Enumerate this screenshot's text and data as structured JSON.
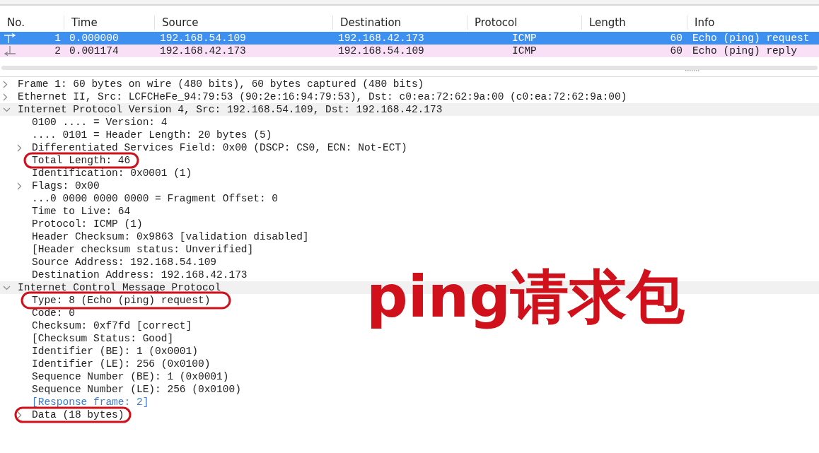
{
  "packet_list": {
    "columns": [
      "No.",
      "Time",
      "Source",
      "Destination",
      "Protocol",
      "Length",
      "Info"
    ],
    "rows": [
      {
        "no": "1",
        "time": "0.000000",
        "source": "192.168.54.109",
        "destination": "192.168.42.173",
        "protocol": "ICMP",
        "length": "60",
        "info": "Echo (ping) request",
        "kind": "request",
        "selected": true
      },
      {
        "no": "2",
        "time": "0.001174",
        "source": "192.168.42.173",
        "destination": "192.168.54.109",
        "protocol": "ICMP",
        "length": "60",
        "info": "Echo (ping) reply",
        "kind": "reply",
        "selected": false
      }
    ]
  },
  "details": [
    {
      "text": "Frame 1: 60 bytes on wire (480 bits), 60 bytes captured (480 bits)",
      "expanded": false
    },
    {
      "text": "Ethernet II, Src: LCFCHeFe_94:79:53 (90:2e:16:94:79:53), Dst: c0:ea:72:62:9a:00 (c0:ea:72:62:9a:00)",
      "expanded": false
    },
    {
      "text": "Internet Protocol Version 4, Src: 192.168.54.109, Dst: 192.168.42.173",
      "expanded": true,
      "children": [
        {
          "text": "0100 .... = Version: 4"
        },
        {
          "text": ".... 0101 = Header Length: 20 bytes (5)"
        },
        {
          "text": "Differentiated Services Field: 0x00 (DSCP: CS0, ECN: Not-ECT)",
          "expanded": false
        },
        {
          "text": "Total Length: 46"
        },
        {
          "text": "Identification: 0x0001 (1)"
        },
        {
          "text": "Flags: 0x00",
          "expanded": false
        },
        {
          "text": "...0 0000 0000 0000 = Fragment Offset: 0"
        },
        {
          "text": "Time to Live: 64"
        },
        {
          "text": "Protocol: ICMP (1)"
        },
        {
          "text": "Header Checksum: 0x9863 [validation disabled]"
        },
        {
          "text": "[Header checksum status: Unverified]"
        },
        {
          "text": "Source Address: 192.168.54.109"
        },
        {
          "text": "Destination Address: 192.168.42.173"
        }
      ]
    },
    {
      "text": "Internet Control Message Protocol",
      "expanded": true,
      "children": [
        {
          "text": "Type: 8 (Echo (ping) request)"
        },
        {
          "text": "Code: 0"
        },
        {
          "text": "Checksum: 0xf7fd [correct]"
        },
        {
          "text": "[Checksum Status: Good]"
        },
        {
          "text": "Identifier (BE): 1 (0x0001)"
        },
        {
          "text": "Identifier (LE): 256 (0x0100)"
        },
        {
          "text": "Sequence Number (BE): 1 (0x0001)"
        },
        {
          "text": "Sequence Number (LE): 256 (0x0100)"
        },
        {
          "text": "[Response frame: 2]",
          "kind": "link"
        },
        {
          "text": "Data (18 bytes)",
          "expanded": false
        }
      ]
    }
  ],
  "annotation": {
    "text": "ping请求包"
  }
}
